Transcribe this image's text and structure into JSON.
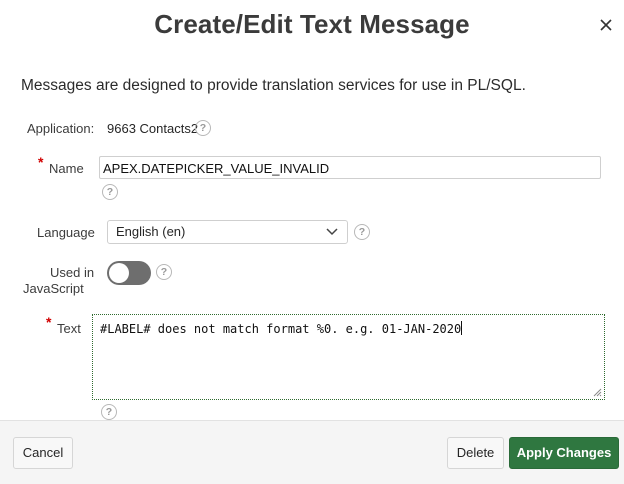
{
  "dialog": {
    "title": "Create/Edit Text Message",
    "intro": "Messages are designed to provide translation services for use in PL/SQL."
  },
  "fields": {
    "application": {
      "label": "Application:",
      "value": "9663 Contacts2"
    },
    "name": {
      "label": "Name",
      "value": "APEX.DATEPICKER_VALUE_INVALID",
      "required_mark": "*"
    },
    "language": {
      "label": "Language",
      "selected": "English (en)"
    },
    "used_in_js": {
      "label_line1": "Used in",
      "label_line2": "JavaScript",
      "state": "off"
    },
    "text": {
      "label": "Text",
      "value": "#LABEL# does not match format %0. e.g. 01-JAN-2020",
      "required_mark": "*"
    }
  },
  "help": {
    "glyph": "?"
  },
  "icons": {
    "close": "close-icon",
    "dropdown": "chevron-down-icon",
    "help": "help-icon"
  },
  "buttons": {
    "cancel": "Cancel",
    "delete": "Delete",
    "apply": "Apply Changes"
  },
  "colors": {
    "primary_button": "#2f7740",
    "required": "#d10000",
    "toggle_off": "#6e6e6e"
  }
}
